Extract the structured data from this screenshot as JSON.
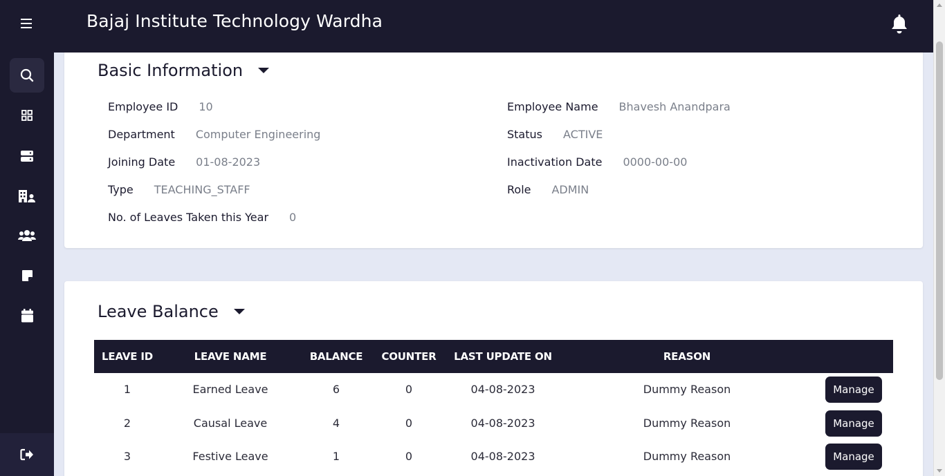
{
  "app": {
    "title": "Bajaj Institute Technology Wardha"
  },
  "sidebar": {
    "items": [
      {
        "icon": "menu-icon"
      },
      {
        "icon": "search-icon"
      },
      {
        "icon": "dashboard-grid-icon"
      },
      {
        "icon": "server-icon"
      },
      {
        "icon": "building-user-icon"
      },
      {
        "icon": "users-icon"
      },
      {
        "icon": "note-icon"
      },
      {
        "icon": "calendar-icon"
      }
    ],
    "logout_icon": "logout-icon"
  },
  "basic_info": {
    "title": "Basic Information",
    "fields": {
      "employee_id": {
        "label": "Employee ID",
        "value": "10"
      },
      "department": {
        "label": "Department",
        "value": "Computer Engineering"
      },
      "joining_date": {
        "label": "Joining Date",
        "value": "01-08-2023"
      },
      "type": {
        "label": "Type",
        "value": "TEACHING_STAFF"
      },
      "leaves_taken": {
        "label": "No. of Leaves Taken this Year",
        "value": "0"
      },
      "employee_name": {
        "label": "Employee Name",
        "value": "Bhavesh Anandpara"
      },
      "status": {
        "label": "Status",
        "value": "ACTIVE"
      },
      "inactivation_date": {
        "label": "Inactivation Date",
        "value": "0000-00-00"
      },
      "role": {
        "label": "Role",
        "value": "ADMIN"
      }
    }
  },
  "leave_balance": {
    "title": "Leave Balance",
    "columns": [
      "LEAVE ID",
      "LEAVE NAME",
      "BALANCE",
      "COUNTER",
      "LAST UPDATE ON",
      "REASON"
    ],
    "rows": [
      {
        "id": "1",
        "name": "Earned Leave",
        "balance": "6",
        "counter": "0",
        "updated": "04-08-2023",
        "reason": "Dummy Reason",
        "action": "Manage"
      },
      {
        "id": "2",
        "name": "Causal Leave",
        "balance": "4",
        "counter": "0",
        "updated": "04-08-2023",
        "reason": "Dummy Reason",
        "action": "Manage"
      },
      {
        "id": "3",
        "name": "Festive Leave",
        "balance": "1",
        "counter": "0",
        "updated": "04-08-2023",
        "reason": "Dummy Reason",
        "action": "Manage"
      }
    ]
  },
  "colors": {
    "primary": "#1b1a2e",
    "background": "#e4e8f4",
    "muted_text": "#7a7f8a"
  }
}
